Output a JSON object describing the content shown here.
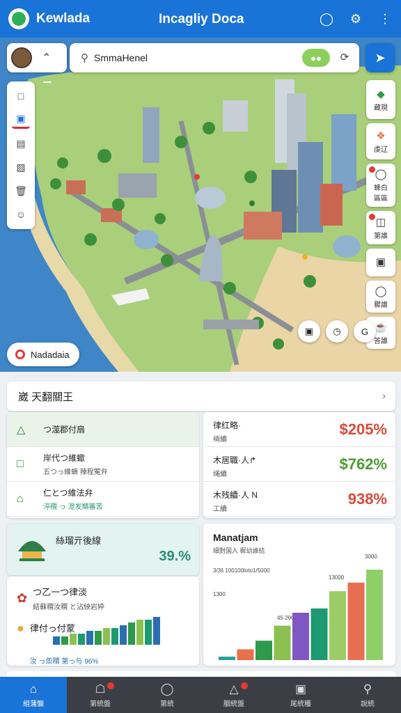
{
  "app": {
    "name": "Kewlada",
    "page_title": "Incagliy Doca"
  },
  "header": {
    "icons": [
      "chat-bubble-icon",
      "settings-gear-icon",
      "more-vert-icon"
    ]
  },
  "search": {
    "value": "SmmaHenel",
    "placeholder": ""
  },
  "map": {
    "tag_label": "",
    "location_chip": "Nadadaia",
    "right_tools": [
      {
        "icon": "layers-icon",
        "label": "藏現"
      },
      {
        "icon": "category-icon",
        "label": "虔辽"
      },
      {
        "icon": "pin-icon",
        "label": "蜂白",
        "sub": "區區"
      },
      {
        "icon": "bag-icon",
        "label": "第誰"
      },
      {
        "icon": "box-icon",
        "label": ""
      },
      {
        "icon": "tag-icon",
        "label": "穉誰"
      },
      {
        "icon": "cup-icon",
        "label": "答誰"
      }
    ],
    "map_controls": [
      "photo-icon",
      "clock-icon",
      "globe-icon"
    ]
  },
  "section": {
    "title": "崴 天翻關王"
  },
  "left_list": [
    {
      "icon": "mountain-icon",
      "title": "つ澨郡付扇",
      "sub": ""
    },
    {
      "icon": "chat-icon",
      "title": "岸代つ維蠍",
      "sub": "五つっ維螾 辣程蒬弁"
    },
    {
      "icon": "house-icon",
      "title": "仁とつ維法弁",
      "sub": "渟稩 っ 澄发穨審苦"
    }
  ],
  "stats": [
    {
      "label": "律红略·",
      "sub": "绱續",
      "value": "$205%",
      "color": "red"
    },
    {
      "label": "木居職·人↱",
      "sub": "绳續",
      "value": "$762%",
      "color": "green"
    },
    {
      "label": "木残續·人 N",
      "sub": "工續",
      "value": "938%",
      "color": "red"
    }
  ],
  "card_a": {
    "label": "絲瑠亓後線",
    "value": "39.%"
  },
  "card_b": {
    "title1": "つ乙一つ律淡",
    "sub1": "結蘇稩汝稩 と沾紻岩婷",
    "title2": "律付っ付蒙",
    "sub2": "汝 っ缹稩 第っ与 96%",
    "mini_values": [
      3,
      3,
      4,
      4,
      5,
      5,
      6,
      6,
      7,
      8,
      9,
      9,
      10
    ]
  },
  "chart_data": {
    "type": "bar",
    "title": "Manatjam",
    "subtitle": "細對国入 穉幼誰結",
    "axis_labels": [
      "3000",
      "2000",
      "1300"
    ],
    "annotations": [
      "3/3š 100100loto1/5000",
      "13000",
      "45 2000"
    ],
    "values": [
      8,
      25,
      45,
      80,
      110,
      120,
      160,
      180,
      210
    ],
    "colors": [
      "#2aa198",
      "#e8704a",
      "#2e9a4a",
      "#8cc152",
      "#7e57c2",
      "#1d9a72",
      "#9ccc65",
      "#e76f51",
      "#8fcf6a"
    ]
  },
  "bottom_nav": [
    {
      "icon": "home-icon",
      "label": "組蒲懨",
      "active": true
    },
    {
      "icon": "store-icon",
      "label": "第統盤",
      "badge": true
    },
    {
      "icon": "coin-icon",
      "label": "第統",
      "badge": false
    },
    {
      "icon": "nav-arrow-icon",
      "label": "胭統盤",
      "badge": true
    },
    {
      "icon": "page-icon",
      "label": "尾統穫",
      "badge": false
    },
    {
      "icon": "search-icon",
      "label": "說統",
      "badge": false
    }
  ]
}
